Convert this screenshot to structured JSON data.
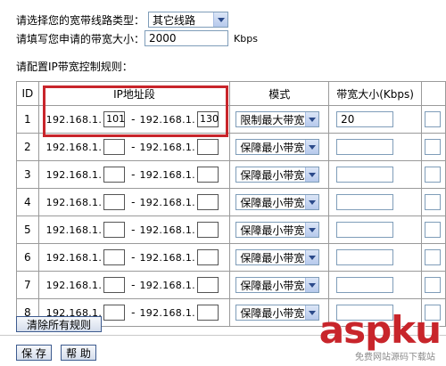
{
  "line_type": {
    "label": "请选择您的宽带线路类型：",
    "selected": "其它线路"
  },
  "bandwidth": {
    "label": "请填写您申请的带宽大小：",
    "value": "2000",
    "unit": "Kbps"
  },
  "rules_label": "请配置IP带宽控制规则：",
  "table": {
    "headers": {
      "id": "ID",
      "ip_range": "IP地址段",
      "mode": "模式",
      "bandwidth": "带宽大小(Kbps)"
    },
    "ip_prefix": "192.168.1.",
    "dash": "-",
    "rows": [
      {
        "id": "1",
        "start": "101",
        "end": "130",
        "mode": "限制最大带宽",
        "bw": "20"
      },
      {
        "id": "2",
        "start": "",
        "end": "",
        "mode": "保障最小带宽",
        "bw": ""
      },
      {
        "id": "3",
        "start": "",
        "end": "",
        "mode": "保障最小带宽",
        "bw": ""
      },
      {
        "id": "4",
        "start": "",
        "end": "",
        "mode": "保障最小带宽",
        "bw": ""
      },
      {
        "id": "5",
        "start": "",
        "end": "",
        "mode": "保障最小带宽",
        "bw": ""
      },
      {
        "id": "6",
        "start": "",
        "end": "",
        "mode": "保障最小带宽",
        "bw": ""
      },
      {
        "id": "7",
        "start": "",
        "end": "",
        "mode": "保障最小带宽",
        "bw": ""
      },
      {
        "id": "8",
        "start": "",
        "end": "",
        "mode": "保障最小带宽",
        "bw": ""
      }
    ]
  },
  "buttons": {
    "clear_rules": "清除所有规则",
    "save": "保 存",
    "help": "帮 助"
  },
  "watermark": {
    "main": "aspku",
    "sub": "免费网站源码下载站"
  },
  "colors": {
    "highlight": "#c8252b",
    "border": "#7f9db9"
  }
}
